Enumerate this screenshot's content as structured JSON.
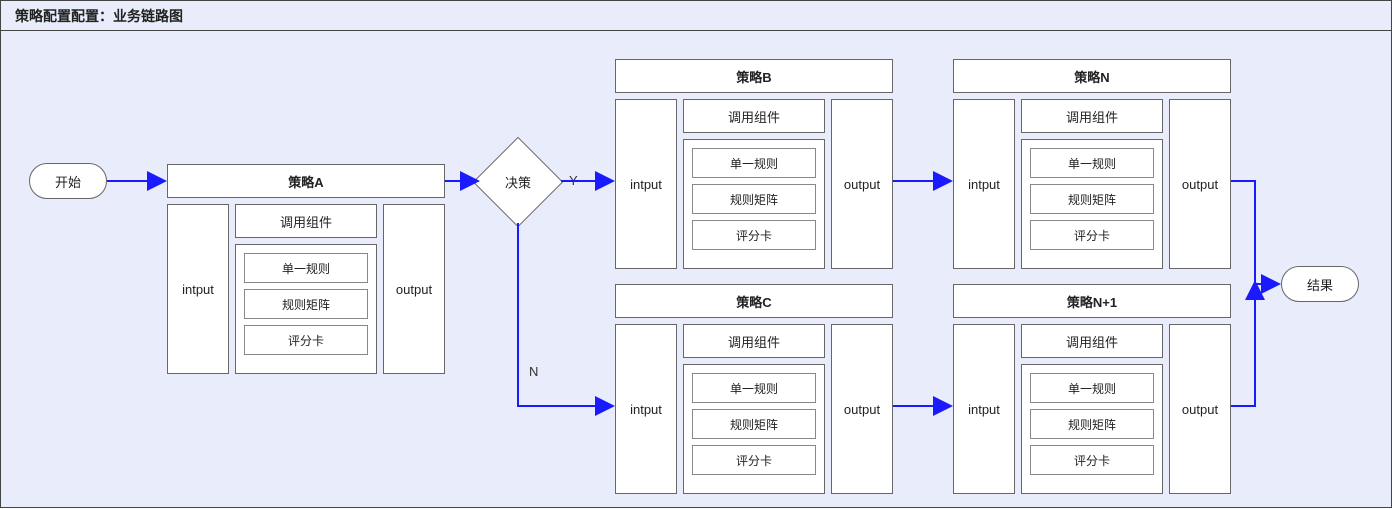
{
  "panel": {
    "title": "策略配置配置：业务链路图"
  },
  "start": {
    "label": "开始"
  },
  "end": {
    "label": "结果"
  },
  "decision": {
    "label": "决策",
    "yes": "Y",
    "no": "N"
  },
  "common": {
    "intput": "intput",
    "output": "output",
    "invoke": "调用组件",
    "rules": [
      "单一规则",
      "规则矩阵",
      "评分卡"
    ]
  },
  "strategies": {
    "A": {
      "title": "策略A"
    },
    "B": {
      "title": "策略B"
    },
    "C": {
      "title": "策略C"
    },
    "N": {
      "title": "策略N"
    },
    "N1": {
      "title": "策略N+1"
    }
  }
}
